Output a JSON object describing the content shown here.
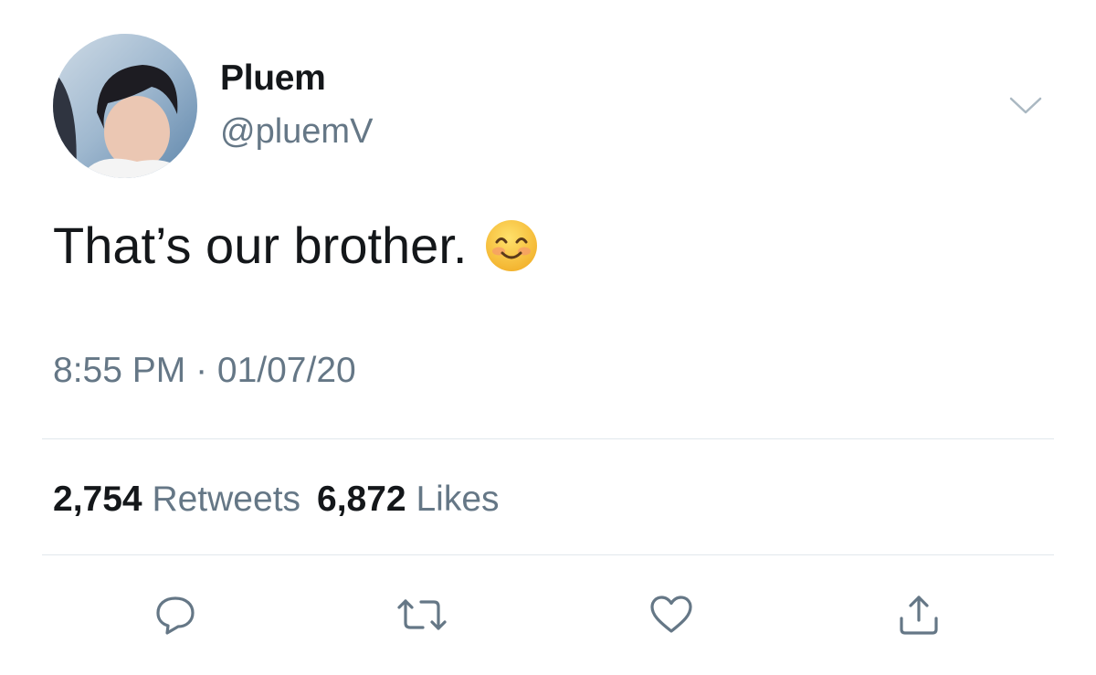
{
  "tweet": {
    "display_name": "Pluem",
    "handle": "@pluemV",
    "text": "That’s our brother.",
    "emoji": "smiling-face-with-smiling-eyes",
    "timestamp": "8:55 PM · 01/07/20",
    "stats": {
      "retweets_count": "2,754",
      "retweets_label": "Retweets",
      "likes_count": "6,872",
      "likes_label": "Likes"
    },
    "actions": [
      {
        "name": "reply",
        "icon": "reply-icon"
      },
      {
        "name": "retweet",
        "icon": "retweet-icon"
      },
      {
        "name": "like",
        "icon": "heart-icon"
      },
      {
        "name": "share",
        "icon": "share-icon"
      }
    ]
  },
  "colors": {
    "primary_text": "#14171a",
    "secondary_text": "#657786",
    "divider": "#e1e8ed",
    "emoji_yellow": "#f7c33a"
  }
}
